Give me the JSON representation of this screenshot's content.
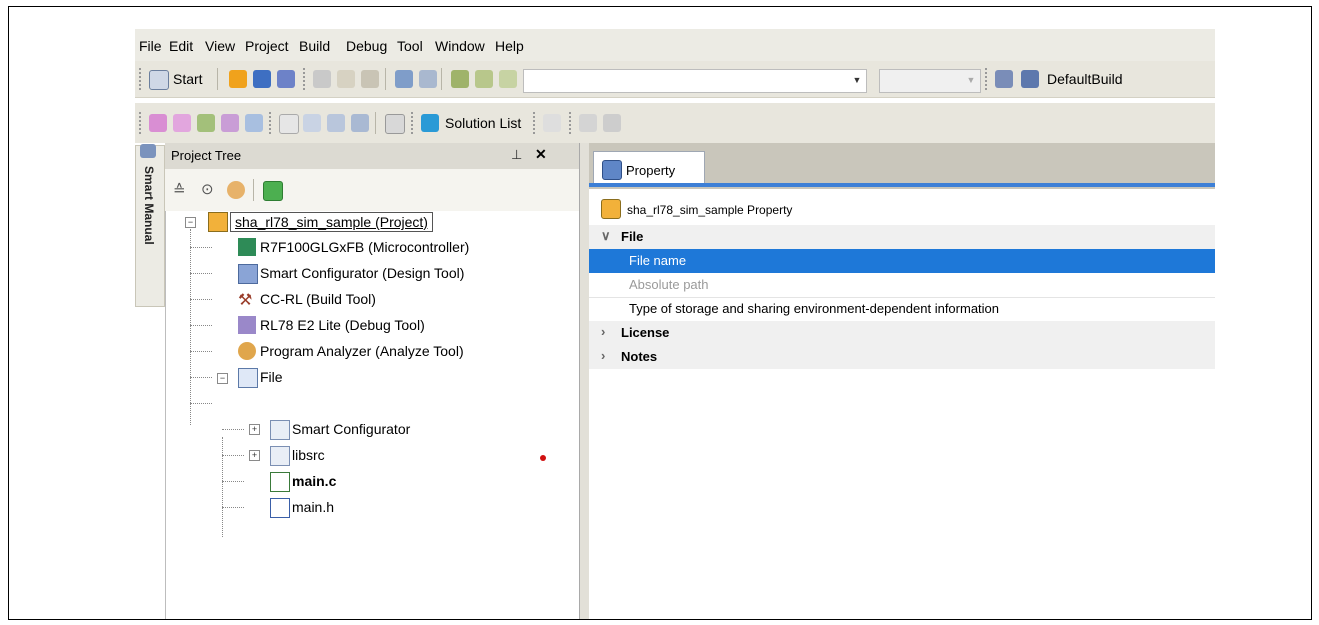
{
  "menu": [
    "File",
    "Edit",
    "View",
    "Project",
    "Build",
    "Debug",
    "Tool",
    "Window",
    "Help"
  ],
  "toolbar1": {
    "start_label": "Start",
    "build_mode": "DefaultBuild"
  },
  "toolbar2": {
    "solution_list_label": "Solution List"
  },
  "side_tab": "Smart Manual",
  "project_tree": {
    "title": "Project Tree",
    "pin_icon": "pin-icon",
    "close_symbol": "✕",
    "items": [
      {
        "label": "sha_rl78_sim_sample (Project)",
        "icon": "project-icon"
      },
      {
        "label": "R7F100GLGxFB (Microcontroller)",
        "icon": "microcontroller-icon"
      },
      {
        "label": "Smart Configurator (Design Tool)",
        "icon": "design-tool-icon"
      },
      {
        "label": "CC-RL (Build Tool)",
        "icon": "build-tool-icon"
      },
      {
        "label": "RL78 E2 Lite (Debug Tool)",
        "icon": "debug-tool-icon"
      },
      {
        "label": "Program Analyzer (Analyze Tool)",
        "icon": "analyze-tool-icon"
      },
      {
        "label": "File",
        "icon": "folder-icon"
      },
      {
        "label": "Smart Configurator",
        "icon": "folder-icon"
      },
      {
        "label": "libsrc",
        "icon": "folder-icon"
      },
      {
        "label": "main.c",
        "icon": "c-file-icon"
      },
      {
        "label": "main.h",
        "icon": "h-file-icon"
      }
    ]
  },
  "property": {
    "tab_label": "Property",
    "title": "sha_rl78_sim_sample Property",
    "categories": [
      {
        "name": "File",
        "expanded": true,
        "rows": [
          "File name",
          "Absolute path",
          "Type of storage and sharing environment-dependent information"
        ]
      },
      {
        "name": "License",
        "expanded": false
      },
      {
        "name": "Notes",
        "expanded": false
      }
    ],
    "selected_row": "File name"
  },
  "colors": {
    "selection": "#1e78d8",
    "accent_line": "#3d7fd6",
    "marker": "#d01010"
  }
}
